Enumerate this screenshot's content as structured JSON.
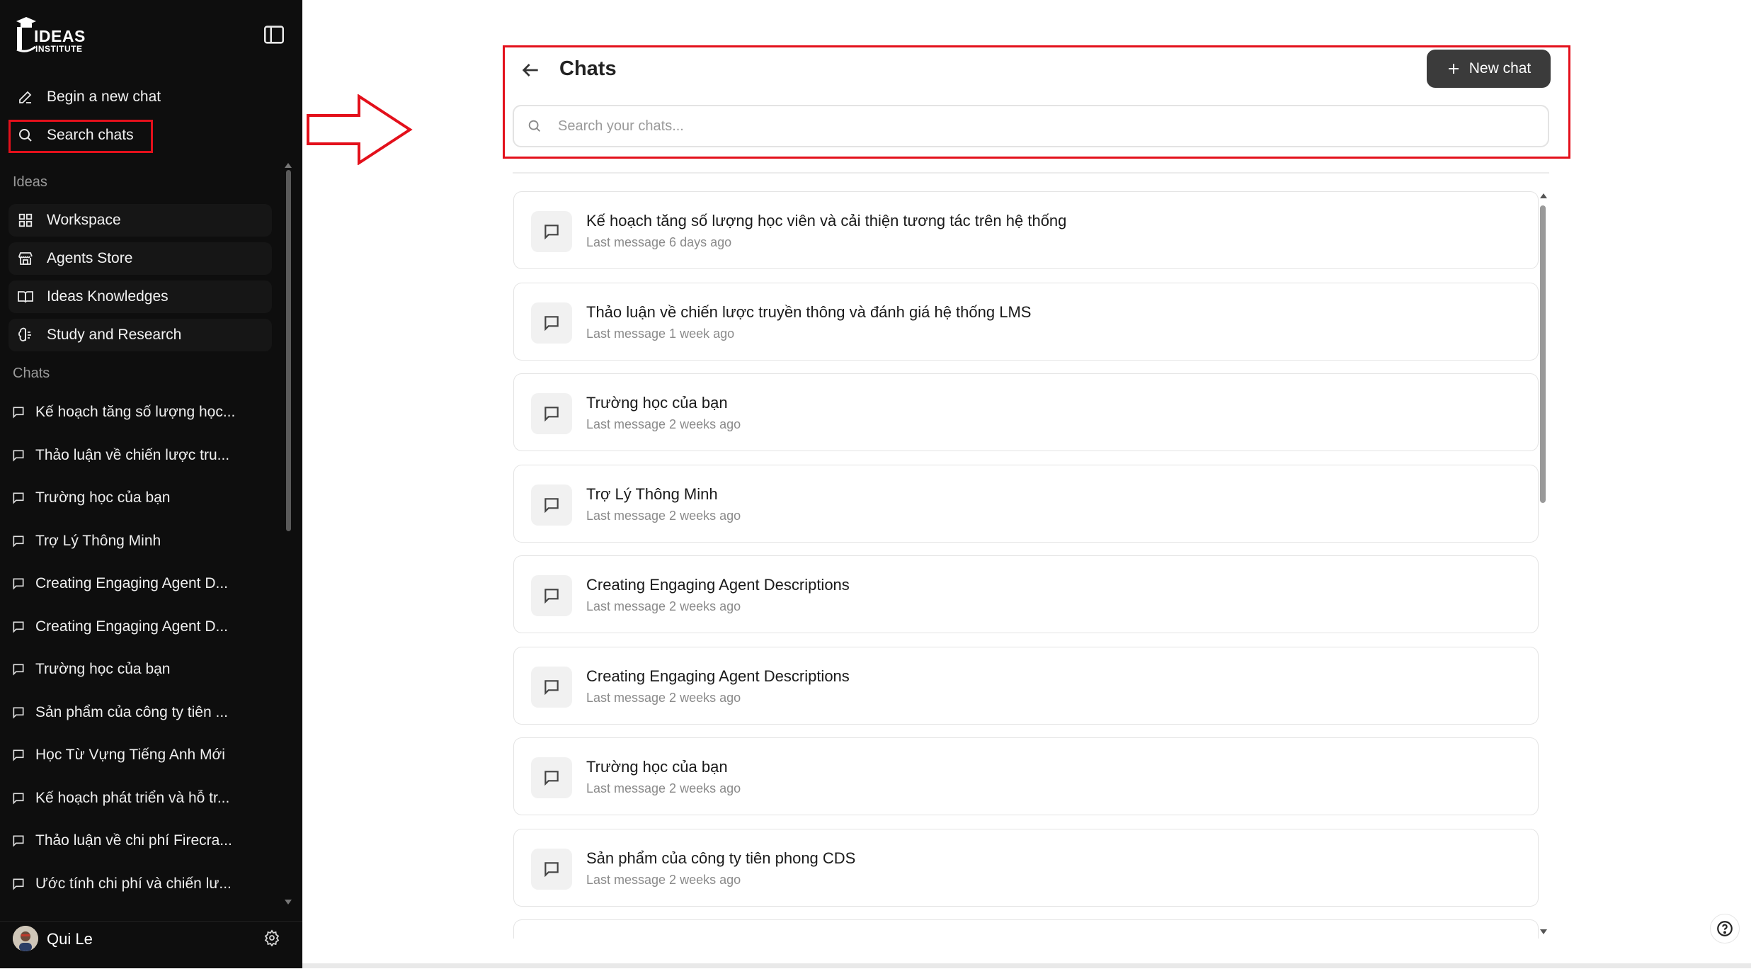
{
  "brand": {
    "logo_word1": "IDEAS",
    "logo_word2": "INSTITUTE"
  },
  "sidebar": {
    "actions": [
      {
        "label": "Begin a new chat",
        "icon": "pencil-icon"
      },
      {
        "label": "Search chats",
        "icon": "search-icon"
      }
    ],
    "ideas_label": "Ideas",
    "ideas_items": [
      {
        "label": "Workspace",
        "icon": "grid-icon"
      },
      {
        "label": "Agents Store",
        "icon": "store-icon"
      },
      {
        "label": "Ideas Knowledges",
        "icon": "book-icon"
      },
      {
        "label": "Study and Research",
        "icon": "brain-icon"
      }
    ],
    "chats_label": "Chats",
    "chats": [
      "Kế hoạch tăng số lượng học...",
      "Thảo luận về chiến lược tru...",
      "Trường học của bạn",
      "Trợ Lý Thông Minh",
      "Creating Engaging Agent D...",
      "Creating Engaging Agent D...",
      "Trường học của bạn",
      "Sản phẩm của công ty tiên ...",
      "Học Từ Vựng Tiếng Anh Mới",
      "Kế hoạch phát triển và hỗ tr...",
      "Thảo luận về chi phí Firecra...",
      "Ước tính chi phí và chiến lư..."
    ],
    "user_name": "Qui Le"
  },
  "main": {
    "title": "Chats",
    "new_chat_label": "New chat",
    "search_placeholder": "Search your chats...",
    "chats": [
      {
        "title": "Kế hoạch tăng số lượng học viên và cải thiện tương tác trên hệ thống",
        "subtitle": "Last message 6 days ago"
      },
      {
        "title": "Thảo luận về chiến lược truyền thông và đánh giá hệ thống LMS",
        "subtitle": "Last message 1 week ago"
      },
      {
        "title": "Trường học của bạn",
        "subtitle": "Last message 2 weeks ago"
      },
      {
        "title": "Trợ Lý Thông Minh",
        "subtitle": "Last message 2 weeks ago"
      },
      {
        "title": "Creating Engaging Agent Descriptions",
        "subtitle": "Last message 2 weeks ago"
      },
      {
        "title": "Creating Engaging Agent Descriptions",
        "subtitle": "Last message 2 weeks ago"
      },
      {
        "title": "Trường học của bạn",
        "subtitle": "Last message 2 weeks ago"
      },
      {
        "title": "Sản phẩm của công ty tiên phong CDS",
        "subtitle": "Last message 2 weeks ago"
      },
      {
        "title": "",
        "subtitle": ""
      }
    ]
  },
  "colors": {
    "sidebar_bg": "#0e0e0e",
    "annotation_red": "#e3101b",
    "button_dark": "#3b3b3b"
  }
}
